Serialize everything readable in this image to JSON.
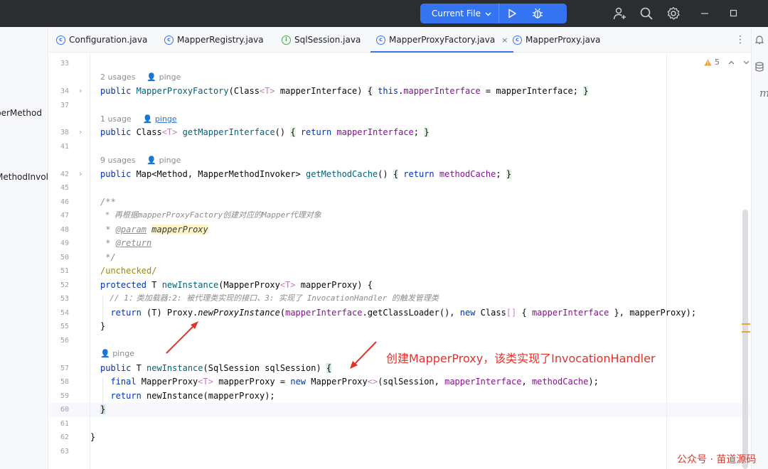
{
  "titlebar": {
    "run_config": "Current File",
    "colors": {
      "bar": "#2b2d30",
      "accent": "#3574f0"
    },
    "icons": [
      "run-icon",
      "debug-icon",
      "add-user-icon",
      "search-icon",
      "settings-icon",
      "minimize-icon",
      "maximize-icon"
    ]
  },
  "left_strip": {
    "item1": "perMethod",
    "item2": "MethodInvok"
  },
  "right_strip": {
    "item": "m"
  },
  "tabs": [
    {
      "label": "Configuration.java",
      "icon": "class-icon"
    },
    {
      "label": "MapperRegistry.java",
      "icon": "class-icon"
    },
    {
      "label": "SqlSession.java",
      "icon": "interface-icon"
    },
    {
      "label": "MapperProxyFactory.java",
      "icon": "class-icon",
      "active": true,
      "close": "×"
    },
    {
      "label": "MapperProxy.java",
      "icon": "class-icon"
    }
  ],
  "tabs_more": "⋮",
  "editor": {
    "warnings": "5",
    "line_numbers": [
      "33",
      "34",
      "37",
      "38",
      "41",
      "42",
      "45",
      "46",
      "47",
      "48",
      "49",
      "50",
      "51",
      "52",
      "53",
      "54",
      "55",
      "56",
      "57",
      "58",
      "59",
      "60",
      "61",
      "62",
      "63"
    ],
    "hints": {
      "h34_usages": "2 usages",
      "h34_author": "pinge",
      "h38_usages": "1 usage",
      "h38_author": "pinge",
      "h42_usages": "9 usages",
      "h42_author": "pinge",
      "h57_author": "pinge"
    },
    "code": {
      "l34_kw": "public ",
      "l34_name": "MapperProxyFactory",
      "l34_a": "(Class",
      "l34_gen": "<T>",
      "l34_b": " mapperInterface) ",
      "l34_open": "{",
      "l34_this": " this",
      "l34_c": ".",
      "l34_fld": "mapperInterface",
      "l34_d": " = mapperInterface; ",
      "l34_close": "}",
      "l38_kw": "public ",
      "l38_a": "Class",
      "l38_gen": "<T>",
      "l38_sp": " ",
      "l38_name": "getMapperInterface",
      "l38_b": "() ",
      "l38_open": "{",
      "l38_ret": " return ",
      "l38_fld": "mapperInterface",
      "l38_c": "; ",
      "l38_close": "}",
      "l42_kw": "public ",
      "l42_a": "Map<Method, MapperMethodInvoker> ",
      "l42_name": "getMethodCache",
      "l42_b": "() ",
      "l42_open": "{",
      "l42_ret": " return ",
      "l42_fld": "methodCache",
      "l42_c": "; ",
      "l42_close": "}",
      "l46": "/**",
      "l47": " * 再根据mapperProxyFactory创建对应的Mapper代理对象",
      "l48_a": " * ",
      "l48_tag": "@param",
      "l48_sp": " ",
      "l48_param": "mapperProxy",
      "l49_a": " * ",
      "l49_tag": "@return",
      "l50": " */",
      "l51": "/unchecked/",
      "l52_kw": "protected ",
      "l52_a": "T ",
      "l52_name": "newInstance",
      "l52_b": "(MapperProxy",
      "l52_gen": "<T>",
      "l52_c": " mapperProxy) {",
      "l53": "  // 1：类加载器:2: 被代理类实现的接口、3: 实现了 InvocationHandler 的触发管理类",
      "l54_ret": "  return ",
      "l54_a": "(T) Proxy.",
      "l54_itl": "newProxyInstance",
      "l54_b": "(",
      "l54_fld": "mapperInterface",
      "l54_c": ".getClassLoader(), ",
      "l54_new": "new ",
      "l54_d": "Class",
      "l54_gen": "[]",
      "l54_e": " { ",
      "l54_fld2": "mapperInterface",
      "l54_f": " }, mapperProxy);",
      "l55": "}",
      "l57_kw": "public ",
      "l57_a": "T ",
      "l57_name": "newInstance",
      "l57_b": "(SqlSession sqlSession) ",
      "l57_open": "{",
      "l58_kw": "  final ",
      "l58_a": "MapperProxy",
      "l58_gen": "<T>",
      "l58_b": " mapperProxy = ",
      "l58_new": "new ",
      "l58_c": "MapperProxy",
      "l58_gen2": "<>",
      "l58_d": "(sqlSession, ",
      "l58_fld": "mapperInterface",
      "l58_e": ", ",
      "l58_fld2": "methodCache",
      "l58_f": ");",
      "l59_ret": "  return ",
      "l59_a": "newInstance(mapperProxy);",
      "l60": "}",
      "l62": "}"
    }
  },
  "annotation": {
    "callout": "创建MapperProxy，该类实现了InvocationHandler",
    "color": "#e0322b"
  },
  "watermark": "公众号 · 苗道源码"
}
